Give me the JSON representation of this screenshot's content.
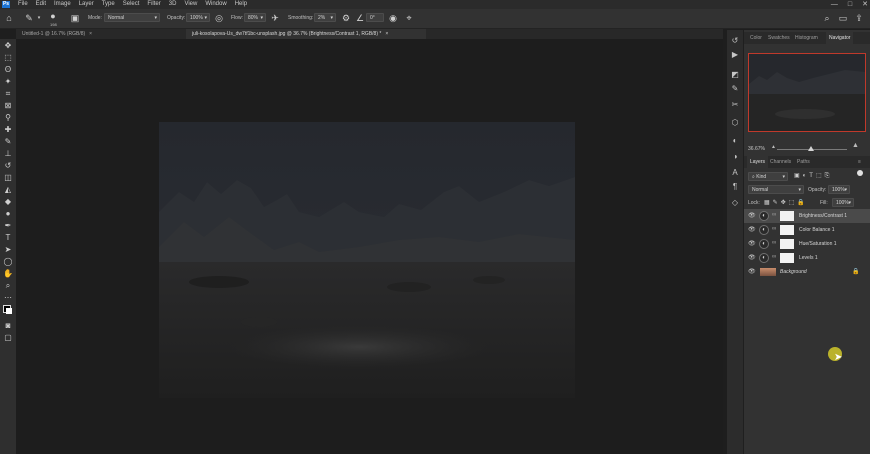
{
  "menu": {
    "logo": "Ps",
    "items": [
      "File",
      "Edit",
      "Image",
      "Layer",
      "Type",
      "Select",
      "Filter",
      "3D",
      "View",
      "Window",
      "Help"
    ],
    "window_controls": [
      "—",
      "□",
      "✕"
    ]
  },
  "options": {
    "brush_size": "198",
    "mode_label": "Mode:",
    "mode_value": "Normal",
    "opacity_label": "Opacity:",
    "opacity_value": "100%",
    "flow_label": "Flow:",
    "flow_value": "80%",
    "smoothing_label": "Smoothing:",
    "smoothing_value": "2%",
    "angle_value": "0°"
  },
  "tabs": [
    {
      "label": "Untitled-1 @ 16.7% (RGB/8)",
      "active": false,
      "close": "×"
    },
    {
      "label": "juli-kosolapova-Us_dw7tf1bc-unsplash.jpg @ 36.7% (Brightness/Contrast 1, RGB/8) *",
      "active": true,
      "close": "×"
    }
  ],
  "panel_top": {
    "tabs": [
      "Color",
      "Swatches",
      "Histogram",
      "Navigator"
    ],
    "active": "Navigator",
    "zoom": "36.67%"
  },
  "layers_panel": {
    "tabs": [
      "Layers",
      "Channels",
      "Paths"
    ],
    "active": "Layers",
    "kind_label": "Kind",
    "blend_mode": "Normal",
    "opacity_label": "Opacity:",
    "opacity_value": "100%",
    "lock_label": "Lock:",
    "fill_label": "Fill:",
    "fill_value": "100%",
    "layers": [
      {
        "name": "Brightness/Contrast 1",
        "type": "adjustment",
        "selected": true
      },
      {
        "name": "Color Balance 1",
        "type": "adjustment",
        "selected": false
      },
      {
        "name": "Hue/Saturation 1",
        "type": "adjustment",
        "selected": false
      },
      {
        "name": "Levels 1",
        "type": "adjustment",
        "selected": false
      },
      {
        "name": "Background",
        "type": "background",
        "selected": false
      }
    ]
  },
  "colors": {
    "accent": "#1c74d4",
    "nav_frame": "#c0392b",
    "cursor_highlight": "#c9c02a"
  }
}
